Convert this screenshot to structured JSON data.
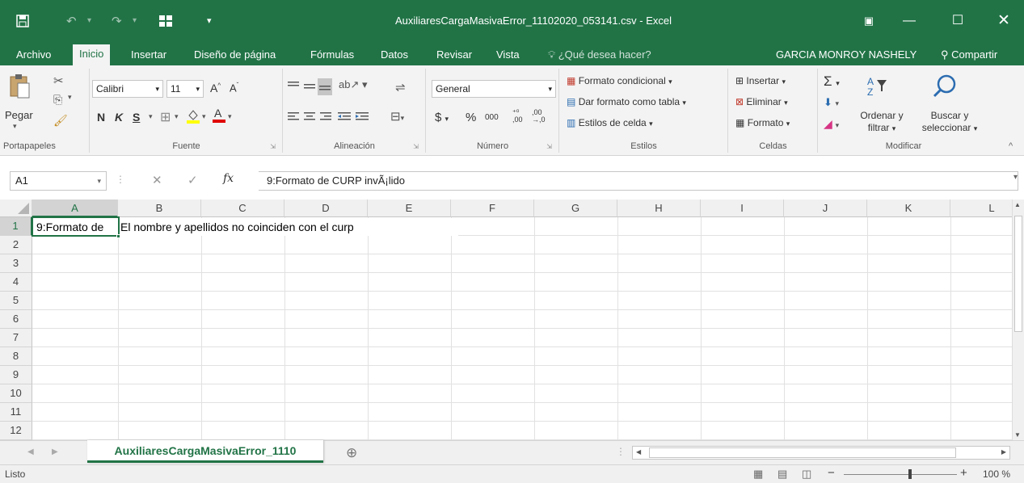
{
  "title_bar": {
    "title": "AuxiliaresCargaMasivaError_11102020_053141.csv - Excel",
    "user": "GARCIA MONROY NASHELY",
    "share": "Compartir"
  },
  "tabs": [
    {
      "label": "Archivo"
    },
    {
      "label": "Inicio"
    },
    {
      "label": "Insertar"
    },
    {
      "label": "Diseño de página"
    },
    {
      "label": "Fórmulas"
    },
    {
      "label": "Datos"
    },
    {
      "label": "Revisar"
    },
    {
      "label": "Vista"
    }
  ],
  "tell_me": "¿Qué desea hacer?",
  "ribbon": {
    "clipboard": {
      "paste": "Pegar",
      "label": "Portapapeles"
    },
    "font": {
      "name": "Calibri",
      "size": "11",
      "bold": "N",
      "italic": "K",
      "underline": "S",
      "label": "Fuente"
    },
    "alignment": {
      "label": "Alineación"
    },
    "number": {
      "format": "General",
      "percent": "%",
      "thousands": "000",
      "label": "Número"
    },
    "styles": {
      "conditional": "Formato condicional",
      "table": "Dar formato como tabla",
      "cell_styles": "Estilos de celda",
      "label": "Estilos"
    },
    "cells": {
      "insert": "Insertar",
      "delete": "Eliminar",
      "format": "Formato",
      "label": "Celdas"
    },
    "editing": {
      "sort_1": "Ordenar y",
      "sort_2": "filtrar",
      "find_1": "Buscar y",
      "find_2": "seleccionar",
      "label": "Modificar"
    }
  },
  "formula_bar": {
    "name_box": "A1",
    "fx": "fx",
    "content": "9:Formato de CURP invÃ¡lido"
  },
  "columns": [
    "A",
    "B",
    "C",
    "D",
    "E",
    "F",
    "G",
    "H",
    "I",
    "J",
    "K",
    "L"
  ],
  "rows": [
    "1",
    "2",
    "3",
    "4",
    "5",
    "6",
    "7",
    "8",
    "9",
    "10",
    "11",
    "12"
  ],
  "cells": {
    "a1": "9:Formato de",
    "b1": "El nombre y apellidos no coinciden con el curp"
  },
  "sheet_tab": "AuxiliaresCargaMasivaError_1110",
  "status": {
    "ready": "Listo",
    "zoom": "100 %"
  },
  "colors": {
    "accent": "#217346"
  }
}
